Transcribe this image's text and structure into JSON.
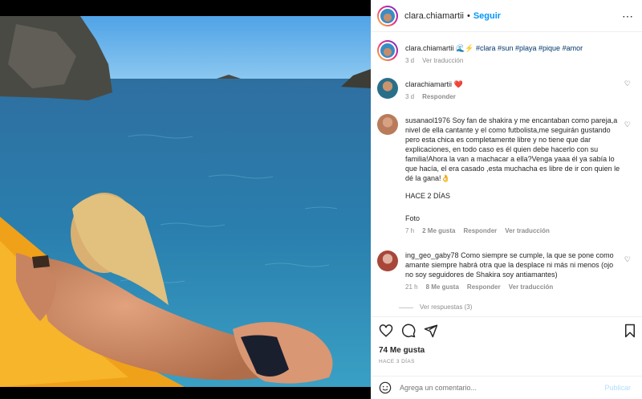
{
  "post": {
    "username": "clara.chiamartii",
    "follow_label": "Seguir",
    "caption_user": "clara.chiamartii",
    "caption_emojis": "🌊⚡",
    "caption_tags": "#clara #sun #playa #pique #amor",
    "caption_time": "3 d",
    "caption_translate": "Ver traducción"
  },
  "comments": [
    {
      "user": "clarachiamartii",
      "text": "❤️",
      "time": "3 d",
      "reply": "Responder"
    },
    {
      "user": "susanaol1976",
      "text": "Soy fan de shakira y me encantaban como pareja,a nivel de ella cantante y el como futbolista,me seguirán gustando pero esta chica es completamente libre y no tiene que dar explicaciones, en todo caso es él quien debe hacerlo con su familia!Ahora la van a machacar a ella?Venga yaaa él ya sabía lo que hacía, el era casado ,esta muchacha es libre de ir con quien le dé la gana!👌",
      "extra1": "HACE 2 DÍAS",
      "extra2": "Foto",
      "time": "7 h",
      "likes": "2 Me gusta",
      "reply": "Responder",
      "translate": "Ver traducción"
    },
    {
      "user": "ing_geo_gaby78",
      "text": "Como siempre se cumple, la que se pone como amante siempre habrá otra que la desplace ni más ni menos (ojo no soy seguidores de Shakira soy antiamantes)",
      "time": "21 h",
      "likes": "8 Me gusta",
      "reply": "Responder",
      "translate": "Ver traducción",
      "view_replies": "Ver respuestas (3)"
    }
  ],
  "footer": {
    "likes": "74 Me gusta",
    "ago": "HACE 3 DÍAS",
    "comment_placeholder": "Agrega un comentario...",
    "publish": "Publicar"
  },
  "colors": {
    "accent": "#0095f6",
    "heart": "#ed4956"
  }
}
